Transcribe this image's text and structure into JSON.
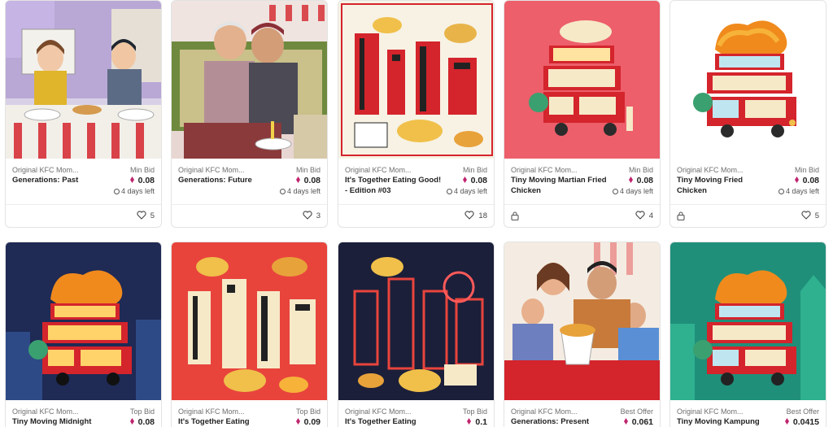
{
  "cards": [
    {
      "collection": "Original KFC Mom...",
      "price_label": "Min Bid",
      "title": "Generations: Past",
      "price": "0.08",
      "time_left": "4 days left",
      "likes": "5",
      "locked": false,
      "art": "generations-past-art"
    },
    {
      "collection": "Original KFC Mom...",
      "price_label": "Min Bid",
      "title": "Generations: Future",
      "price": "0.08",
      "time_left": "4 days left",
      "likes": "3",
      "locked": false,
      "art": "generations-future-art"
    },
    {
      "collection": "Original KFC Mom...",
      "price_label": "Min Bid",
      "title": "It's Together Eating Good! - Edition #03",
      "price": "0.08",
      "time_left": "4 days left",
      "likes": "18",
      "locked": false,
      "art": "together-eating-white-art"
    },
    {
      "collection": "Original KFC Mom...",
      "price_label": "Min Bid",
      "title": "Tiny Moving Martian Fried Chicken",
      "price": "0.08",
      "time_left": "4 days left",
      "likes": "4",
      "locked": true,
      "art": "tiny-moving-martian-art"
    },
    {
      "collection": "Original KFC Mom...",
      "price_label": "Min Bid",
      "title": "Tiny Moving Fried Chicken",
      "price": "0.08",
      "time_left": "4 days left",
      "likes": "5",
      "locked": true,
      "art": "tiny-moving-fried-chicken-art"
    },
    {
      "collection": "Original KFC Mom...",
      "price_label": "Top Bid",
      "title": "Tiny Moving Midnight",
      "price": "0.08",
      "art": "tiny-moving-midnight-art"
    },
    {
      "collection": "Original KFC Mom...",
      "price_label": "Top Bid",
      "title": "It's Together Eating",
      "price": "0.09",
      "art": "together-eating-red-art"
    },
    {
      "collection": "Original KFC Mom...",
      "price_label": "Top Bid",
      "title": "It's Together Eating",
      "price": "0.1",
      "art": "together-eating-dark-art"
    },
    {
      "collection": "Original KFC Mom...",
      "price_label": "Best Offer",
      "title": "Generations: Present",
      "price": "0.061",
      "art": "generations-present-art"
    },
    {
      "collection": "Original KFC Mom...",
      "price_label": "Best Offer",
      "title": "Tiny Moving Kampung",
      "price": "0.0415",
      "art": "tiny-moving-kampung-art"
    }
  ],
  "colors": {
    "eth": "#c0246e",
    "kfc_red": "#d4242c",
    "card_border": "#e3e3e3"
  }
}
